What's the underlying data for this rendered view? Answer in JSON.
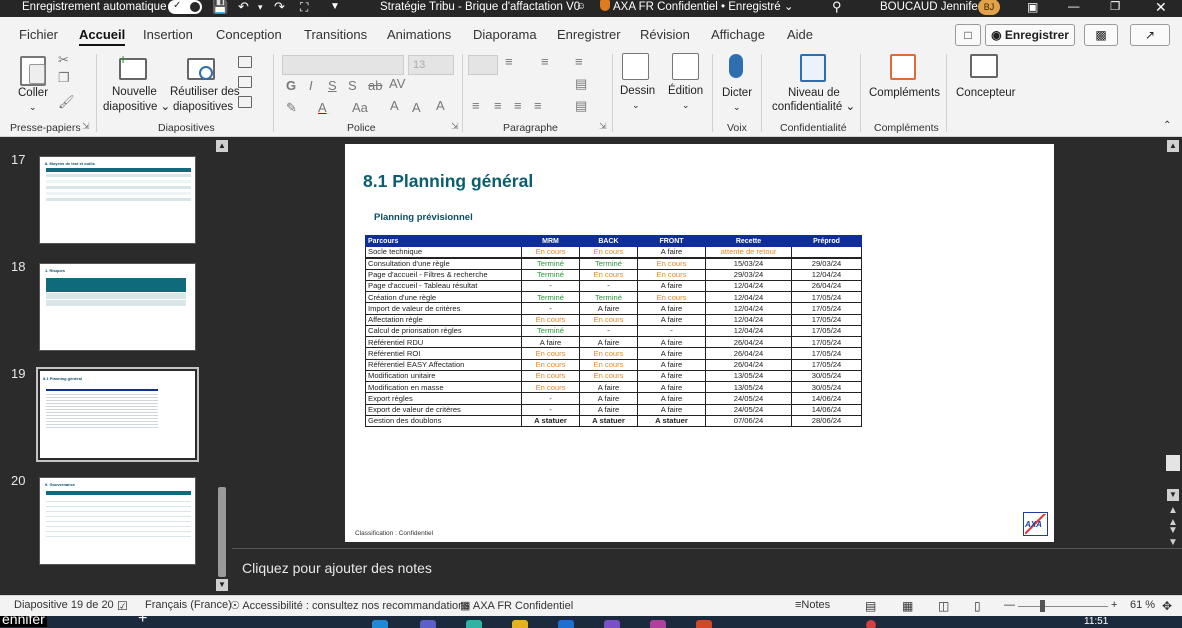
{
  "titlebar": {
    "autosave_label": "Enregistrement automatique",
    "doc_title": "Stratégie Tribu - Brique d'affactation V0",
    "sensitivity": "AXA FR Confidentiel • Enregistré",
    "user_name": "BOUCAUD Jennifer",
    "user_initials": "BJ"
  },
  "tabs": [
    "Fichier",
    "Accueil",
    "Insertion",
    "Conception",
    "Transitions",
    "Animations",
    "Diaporama",
    "Enregistrer",
    "Révision",
    "Affichage",
    "Aide"
  ],
  "active_tab": "Accueil",
  "tabbar_buttons": {
    "record": "Enregistrer"
  },
  "ribbon": {
    "paste": "Coller",
    "new_slide_1": "Nouvelle",
    "new_slide_2": "diapositive",
    "reuse_1": "Réutiliser des",
    "reuse_2": "diapositives",
    "font_size": "13",
    "draw": "Dessin",
    "edit": "Édition",
    "dictate": "Dicter",
    "conf_1": "Niveau de",
    "conf_2": "confidentialité",
    "addins": "Compléments",
    "designer": "Concepteur",
    "groups": {
      "clipboard": "Presse-papiers",
      "slides": "Diapositives",
      "font": "Police",
      "paragraph": "Paragraphe",
      "voice": "Voix",
      "confidentiality": "Confidentialité",
      "addins": "Compléments"
    }
  },
  "thumbnails": [
    {
      "num": "17",
      "title": "8. Moyens de test et outils"
    },
    {
      "num": "18",
      "title": "1. Risques"
    },
    {
      "num": "19",
      "title": "8.1 Planning général"
    },
    {
      "num": "20",
      "title": "9. Gouvernance"
    }
  ],
  "slide": {
    "title": "8.1 Planning général",
    "subtitle": "Planning prévisionnel",
    "classification": "Classification : Confidentiel",
    "logo": "AXA",
    "table": {
      "headers": [
        "Parcours",
        "MRM",
        "BACK",
        "FRONT",
        "Recette",
        "Préprod"
      ],
      "rows": [
        [
          "Socle technique",
          "En cours",
          "En cours",
          "A faire",
          "attente de retour",
          ""
        ],
        [
          "Consultation d'une règle",
          "Terminé",
          "Terminé",
          "En cours",
          "15/03/24",
          "29/03/24"
        ],
        [
          "Page d'accueil - Filtres & recherche",
          "Terminé",
          "En cours",
          "En cours",
          "29/03/24",
          "12/04/24"
        ],
        [
          "Page d'accueil - Tableau résultat",
          "-",
          "-",
          "A faire",
          "12/04/24",
          "26/04/24"
        ],
        [
          "Création d'une règle",
          "Terminé",
          "Terminé",
          "En cours",
          "12/04/24",
          "17/05/24"
        ],
        [
          "Import de valeur de critères",
          "-",
          "A faire",
          "A faire",
          "12/04/24",
          "17/05/24"
        ],
        [
          "Affectation règle",
          "En cours",
          "En cours",
          "A faire",
          "12/04/24",
          "17/05/24"
        ],
        [
          "Calcul de priorisation règles",
          "Terminé",
          "-",
          "-",
          "12/04/24",
          "17/05/24"
        ],
        [
          "Référentiel RDU",
          "A faire",
          "A faire",
          "A faire",
          "26/04/24",
          "17/05/24"
        ],
        [
          "Référentiel ROI",
          "En cours",
          "En cours",
          "A faire",
          "26/04/24",
          "17/05/24"
        ],
        [
          "Référentiel EASY Affectation",
          "En cours",
          "En cours",
          "A faire",
          "26/04/24",
          "17/05/24"
        ],
        [
          "Modification unitaire",
          "En cours",
          "En cours",
          "A faire",
          "13/05/24",
          "30/05/24"
        ],
        [
          "Modification en masse",
          "En cours",
          "A faire",
          "A faire",
          "13/05/24",
          "30/05/24"
        ],
        [
          "Export règles",
          "-",
          "A faire",
          "A faire",
          "24/05/24",
          "14/06/24"
        ],
        [
          "Export de valeur de critères",
          "-",
          "A faire",
          "A faire",
          "24/05/24",
          "14/06/24"
        ],
        [
          "Gestion des doublons",
          "A statuer",
          "A statuer",
          "A statuer",
          "07/06/24",
          "28/06/24"
        ]
      ]
    }
  },
  "notes_placeholder": "Cliquez pour ajouter des notes",
  "statusbar": {
    "slide_info": "Diapositive 19 de 20",
    "language": "Français (France)",
    "accessibility": "Accessibilité : consultez nos recommandations",
    "sensitivity": "AXA FR Confidentiel",
    "notes": "Notes",
    "zoom": "61 %"
  },
  "taskbar": {
    "user_fragment": "ennifer",
    "time": "11:51"
  },
  "colors": {
    "status_en_cours": "#e58a2a",
    "status_termine": "#2a9a3c",
    "table_header": "#0f2e9c",
    "slide_title": "#0b5e6f"
  }
}
